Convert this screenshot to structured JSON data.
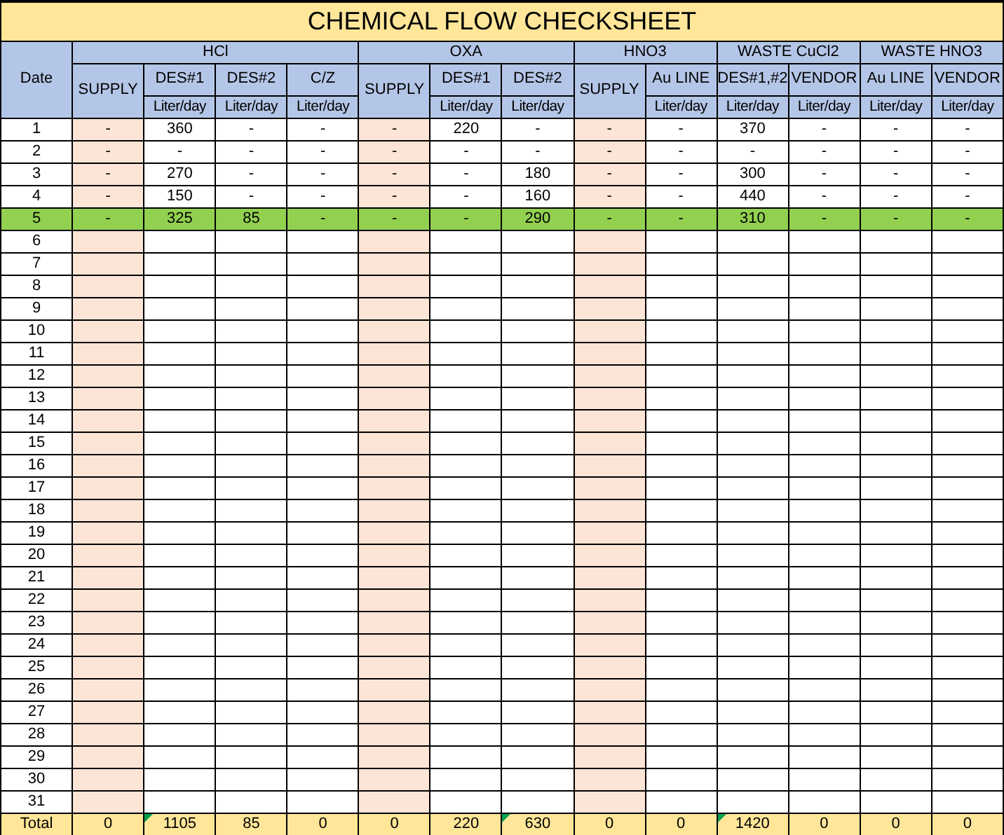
{
  "title": "CHEMICAL FLOW CHECKSHEET",
  "date_header": "Date",
  "groups": [
    {
      "label": "HCl",
      "columns": [
        {
          "label": "SUPPLY",
          "kind": "supply"
        },
        {
          "label": "DES#1",
          "unit": "Liter/day",
          "kind": "flow"
        },
        {
          "label": "DES#2",
          "unit": "Liter/day",
          "kind": "flow"
        },
        {
          "label": "C/Z",
          "unit": "Liter/day",
          "kind": "flow"
        }
      ]
    },
    {
      "label": "OXA",
      "columns": [
        {
          "label": "SUPPLY",
          "kind": "supply"
        },
        {
          "label": "DES#1",
          "unit": "Liter/day",
          "kind": "flow"
        },
        {
          "label": "DES#2",
          "unit": "Liter/day",
          "kind": "flow"
        }
      ]
    },
    {
      "label": "HNO3",
      "columns": [
        {
          "label": "SUPPLY",
          "kind": "supply"
        },
        {
          "label": "Au LINE",
          "unit": "Liter/day",
          "kind": "flow"
        }
      ]
    },
    {
      "label": "WASTE CuCl2",
      "columns": [
        {
          "label": "DES#1,#2",
          "unit": "Liter/day",
          "kind": "flow"
        },
        {
          "label": "VENDOR",
          "unit": "Liter/day",
          "kind": "flow"
        }
      ]
    },
    {
      "label": "WASTE HNO3",
      "columns": [
        {
          "label": "Au LINE",
          "unit": "Liter/day",
          "kind": "flow"
        },
        {
          "label": "VENDOR",
          "unit": "Liter/day",
          "kind": "flow"
        }
      ]
    }
  ],
  "rows": [
    {
      "date": "1",
      "highlighted": false,
      "cells": [
        "-",
        "360",
        "-",
        "-",
        "-",
        "220",
        "-",
        "-",
        "-",
        "370",
        "-",
        "-",
        "-"
      ]
    },
    {
      "date": "2",
      "highlighted": false,
      "cells": [
        "-",
        "-",
        "-",
        "-",
        "-",
        "-",
        "-",
        "-",
        "-",
        "-",
        "-",
        "-",
        "-"
      ]
    },
    {
      "date": "3",
      "highlighted": false,
      "cells": [
        "-",
        "270",
        "-",
        "-",
        "-",
        "-",
        "180",
        "-",
        "-",
        "300",
        "-",
        "-",
        "-"
      ]
    },
    {
      "date": "4",
      "highlighted": false,
      "cells": [
        "-",
        "150",
        "-",
        "-",
        "-",
        "-",
        "160",
        "-",
        "-",
        "440",
        "-",
        "-",
        "-"
      ]
    },
    {
      "date": "5",
      "highlighted": true,
      "cells": [
        "-",
        "325",
        "85",
        "-",
        "-",
        "-",
        "290",
        "-",
        "-",
        "310",
        "-",
        "-",
        "-"
      ]
    },
    {
      "date": "6",
      "highlighted": false
    },
    {
      "date": "7",
      "highlighted": false
    },
    {
      "date": "8",
      "highlighted": false
    },
    {
      "date": "9",
      "highlighted": false
    },
    {
      "date": "10",
      "highlighted": false
    },
    {
      "date": "11",
      "highlighted": false
    },
    {
      "date": "12",
      "highlighted": false
    },
    {
      "date": "13",
      "highlighted": false
    },
    {
      "date": "14",
      "highlighted": false
    },
    {
      "date": "15",
      "highlighted": false
    },
    {
      "date": "16",
      "highlighted": false
    },
    {
      "date": "17",
      "highlighted": false
    },
    {
      "date": "18",
      "highlighted": false
    },
    {
      "date": "19",
      "highlighted": false
    },
    {
      "date": "20",
      "highlighted": false
    },
    {
      "date": "21",
      "highlighted": false
    },
    {
      "date": "22",
      "highlighted": false
    },
    {
      "date": "23",
      "highlighted": false
    },
    {
      "date": "24",
      "highlighted": false
    },
    {
      "date": "25",
      "highlighted": false
    },
    {
      "date": "26",
      "highlighted": false
    },
    {
      "date": "27",
      "highlighted": false
    },
    {
      "date": "28",
      "highlighted": false
    },
    {
      "date": "29",
      "highlighted": false
    },
    {
      "date": "30",
      "highlighted": false
    },
    {
      "date": "31",
      "highlighted": false
    }
  ],
  "total": {
    "label": "Total",
    "cells": [
      {
        "value": "0",
        "flag": false
      },
      {
        "value": "1105",
        "flag": true
      },
      {
        "value": "85",
        "flag": false
      },
      {
        "value": "0",
        "flag": false
      },
      {
        "value": "0",
        "flag": false
      },
      {
        "value": "220",
        "flag": false
      },
      {
        "value": "630",
        "flag": true
      },
      {
        "value": "0",
        "flag": false
      },
      {
        "value": "0",
        "flag": false
      },
      {
        "value": "1420",
        "flag": true
      },
      {
        "value": "0",
        "flag": false
      },
      {
        "value": "0",
        "flag": false
      },
      {
        "value": "0",
        "flag": false
      }
    ]
  }
}
